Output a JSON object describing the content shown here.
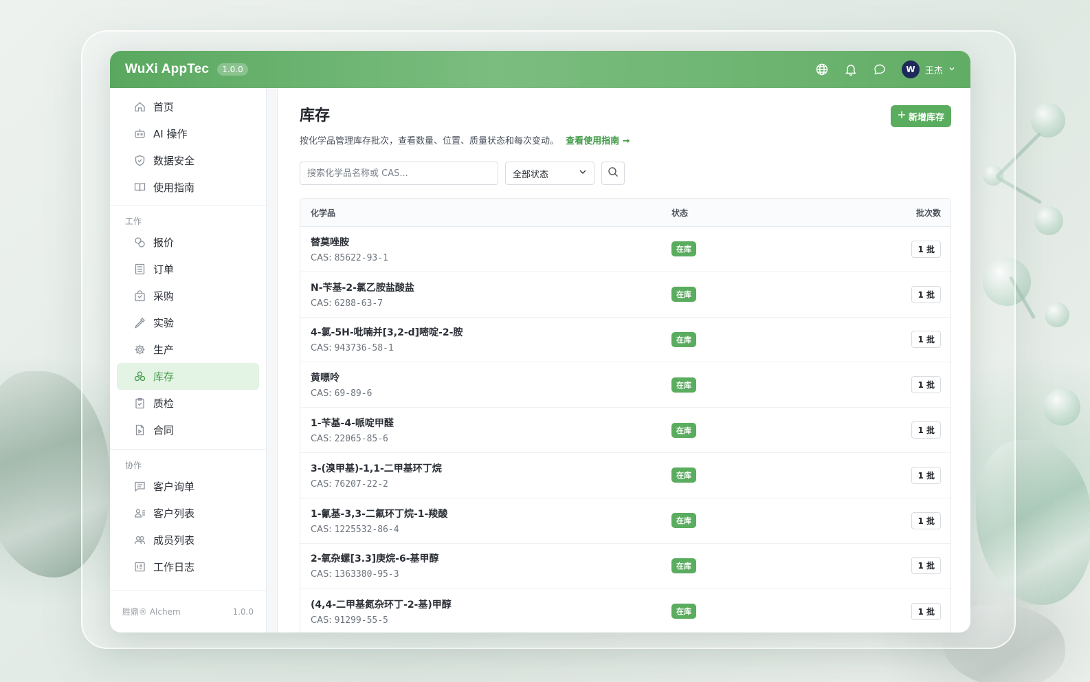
{
  "app": {
    "brand": "WuXi AppTec",
    "version": "1.0.0",
    "user": {
      "avatar_text": "W",
      "name": "王杰"
    },
    "accent_color": "#5aac5e"
  },
  "sidebar": {
    "primary": [
      {
        "label": "首页",
        "icon": "home-icon"
      },
      {
        "label": "AI 操作",
        "icon": "robot-icon"
      },
      {
        "label": "数据安全",
        "icon": "shield-icon"
      },
      {
        "label": "使用指南",
        "icon": "book-icon"
      }
    ],
    "work_title": "工作",
    "work": [
      {
        "label": "报价",
        "icon": "coins-icon"
      },
      {
        "label": "订单",
        "icon": "list-icon"
      },
      {
        "label": "采购",
        "icon": "bag-icon"
      },
      {
        "label": "实验",
        "icon": "pipette-icon"
      },
      {
        "label": "生产",
        "icon": "gear-icon"
      },
      {
        "label": "库存",
        "icon": "boxes-icon",
        "active": true
      },
      {
        "label": "质检",
        "icon": "clipboard-check-icon"
      },
      {
        "label": "合同",
        "icon": "contract-icon"
      }
    ],
    "collab_title": "协作",
    "collab": [
      {
        "label": "客户询单",
        "icon": "message-icon"
      },
      {
        "label": "客户列表",
        "icon": "user-list-icon"
      },
      {
        "label": "成员列表",
        "icon": "users-icon"
      },
      {
        "label": "工作日志",
        "icon": "log-icon"
      }
    ],
    "footer_brand": "胜鼎® Alchem",
    "footer_version": "1.0.0"
  },
  "main": {
    "title": "库存",
    "subtitle": "按化学品管理库存批次，查看数量、位置、质量状态和每次变动。",
    "guide_link": "查看使用指南 →",
    "add_button": "新增库存",
    "search_placeholder": "搜索化学品名称或 CAS...",
    "status_filter": "全部状态",
    "columns": {
      "name": "化学品",
      "status": "状态",
      "batches": "批次数"
    },
    "cas_label": "CAS:",
    "rows": [
      {
        "name": "替莫唑胺",
        "cas": "85622-93-1",
        "status": "在库",
        "batches": "1 批"
      },
      {
        "name": "N-苄基-2-氯乙胺盐酸盐",
        "cas": "6288-63-7",
        "status": "在库",
        "batches": "1 批"
      },
      {
        "name": "4-氯-5H-吡喃并[3,2-d]嘧啶-2-胺",
        "cas": "943736-58-1",
        "status": "在库",
        "batches": "1 批"
      },
      {
        "name": "黄嘌呤",
        "cas": "69-89-6",
        "status": "在库",
        "batches": "1 批"
      },
      {
        "name": "1-苄基-4-哌啶甲醛",
        "cas": "22065-85-6",
        "status": "在库",
        "batches": "1 批"
      },
      {
        "name": "3-(溴甲基)-1,1-二甲基环丁烷",
        "cas": "76207-22-2",
        "status": "在库",
        "batches": "1 批"
      },
      {
        "name": "1-氰基-3,3-二氟环丁烷-1-羧酸",
        "cas": "1225532-86-4",
        "status": "在库",
        "batches": "1 批"
      },
      {
        "name": "2-氧杂螺[3.3]庚烷-6-基甲醇",
        "cas": "1363380-95-3",
        "status": "在库",
        "batches": "1 批"
      },
      {
        "name": "(4,4-二甲基氮杂环丁-2-基)甲醇",
        "cas": "91299-55-5",
        "status": "在库",
        "batches": "1 批"
      }
    ]
  }
}
